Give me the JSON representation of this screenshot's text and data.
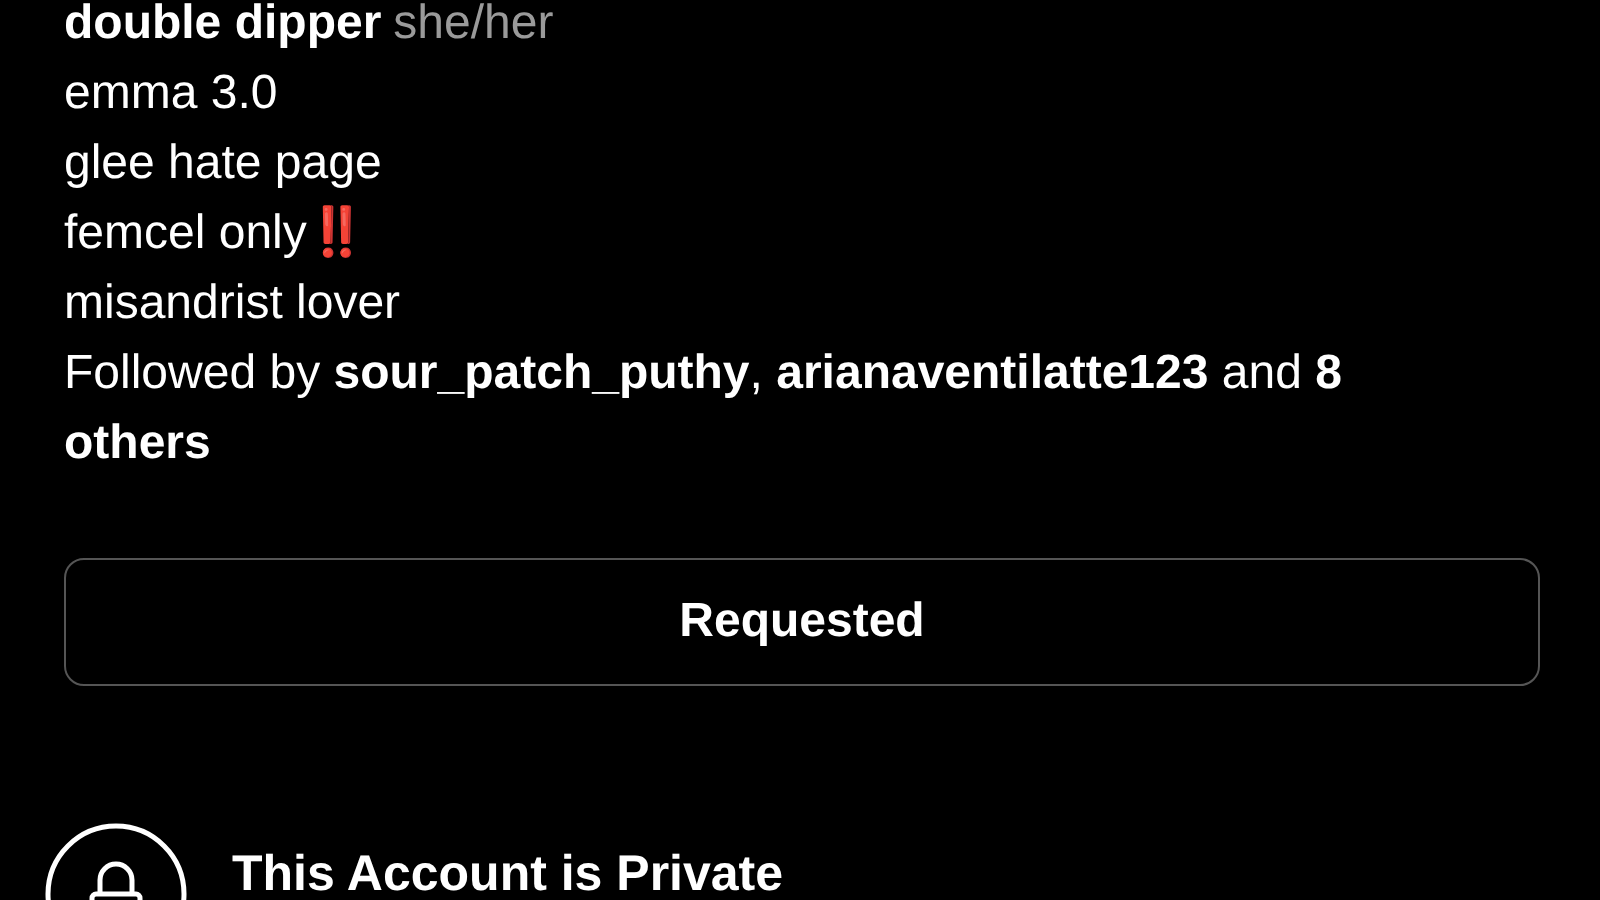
{
  "profile": {
    "name": "double dipper",
    "pronouns": "she/her",
    "bio_lines": [
      {
        "text": "emma 3.0"
      },
      {
        "text": "glee hate page"
      },
      {
        "text": "femcel only",
        "emoji": "‼️"
      },
      {
        "text": "misandrist lover"
      }
    ],
    "followed_by": "Followed by **sour_patch_puthy**, **arianaventilatte123** and **8 others**"
  },
  "follow_button": {
    "label": "Requested"
  },
  "private_notice": {
    "title": "This Account is Private"
  }
}
